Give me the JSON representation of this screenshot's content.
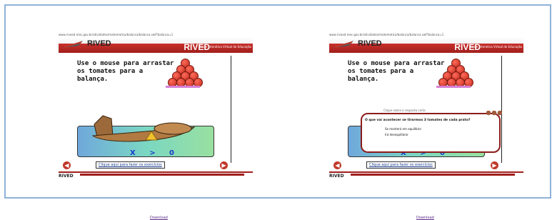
{
  "panels": [
    {
      "url": "www.rivead.mec.gov.br/atividades/matematica/balanca/balanca.swf?balanca=1",
      "logo": "RIVED",
      "brand": "RIVED",
      "brand_sub": "Rede Interativa Virtual de Educação",
      "instruction": "Use o mouse para arrastar os tomates para a balança.",
      "scale_label": "X > 0",
      "link": "Clique aqui para fazer os exercícios",
      "footer_logo": "RIVED",
      "download": "Download"
    },
    {
      "url": "www.rivead.mec.gov.br/atividades/matematica/balanca/balanca.swf?balanca=1",
      "logo": "RIVED",
      "brand": "RIVED",
      "brand_sub": "Rede Interativa Virtual de Educação",
      "instruction": "Use o mouse para arrastar os tomates para a balança.",
      "scale_label": "X > 0",
      "link": "Clique aqui para fazer os exercícios",
      "footer_logo": "RIVED",
      "download": "Download",
      "dialog": {
        "title": "Clique sobre a resposta certa",
        "question": "O que vai acontecer se tirarmos 3 tomates de cada prato?",
        "answers": [
          "Se manterá em equilíbrio",
          "Irá desequilibrar"
        ]
      }
    }
  ]
}
